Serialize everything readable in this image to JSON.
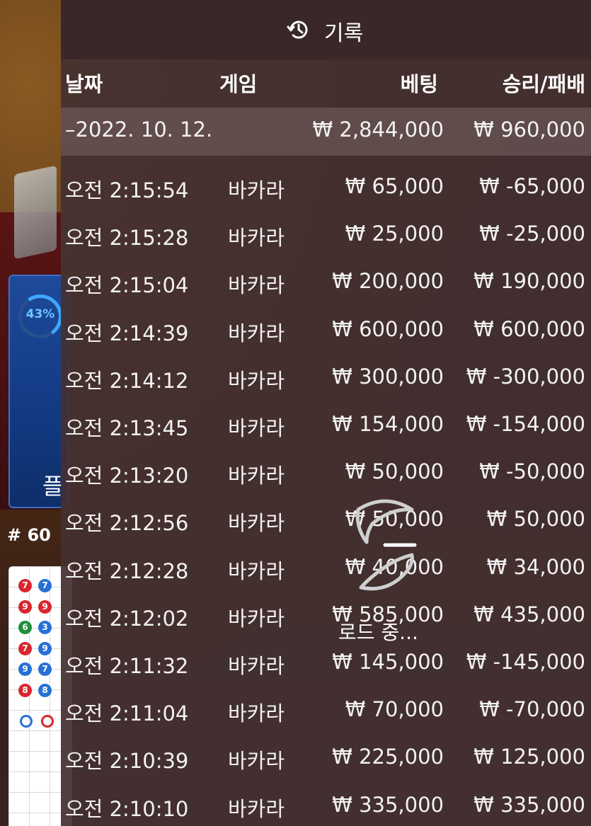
{
  "background": {
    "progress_percent": "43%",
    "player_label": "플",
    "round_number": "# 60",
    "beads": [
      {
        "value": "7",
        "color": "red"
      },
      {
        "value": "7",
        "color": "blue"
      },
      {
        "value": "9",
        "color": "red"
      },
      {
        "value": "9",
        "color": "red"
      },
      {
        "value": "6",
        "color": "green"
      },
      {
        "value": "3",
        "color": "blue"
      },
      {
        "value": "7",
        "color": "red"
      },
      {
        "value": "9",
        "color": "blue"
      },
      {
        "value": "9",
        "color": "blue"
      },
      {
        "value": "7",
        "color": "blue"
      },
      {
        "value": "8",
        "color": "red"
      },
      {
        "value": "8",
        "color": "blue"
      }
    ]
  },
  "panel": {
    "title": "기록",
    "icon": "history-icon",
    "columns": {
      "date": "날짜",
      "game": "게임",
      "bet": "베팅",
      "result": "승리/패배"
    },
    "summary": {
      "date": "–2022. 10. 12.",
      "bet": "₩ 2,844,000",
      "result": "₩ 960,000"
    },
    "rows": [
      {
        "time": "오전 2:15:54",
        "game": "바카라",
        "bet": "₩ 65,000",
        "result": "₩ -65,000"
      },
      {
        "time": "오전 2:15:28",
        "game": "바카라",
        "bet": "₩ 25,000",
        "result": "₩ -25,000"
      },
      {
        "time": "오전 2:15:04",
        "game": "바카라",
        "bet": "₩ 200,000",
        "result": "₩ 190,000"
      },
      {
        "time": "오전 2:14:39",
        "game": "바카라",
        "bet": "₩ 600,000",
        "result": "₩ 600,000"
      },
      {
        "time": "오전 2:14:12",
        "game": "바카라",
        "bet": "₩ 300,000",
        "result": "₩ -300,000"
      },
      {
        "time": "오전 2:13:45",
        "game": "바카라",
        "bet": "₩ 154,000",
        "result": "₩ -154,000"
      },
      {
        "time": "오전 2:13:20",
        "game": "바카라",
        "bet": "₩ 50,000",
        "result": "₩ -50,000"
      },
      {
        "time": "오전 2:12:56",
        "game": "바카라",
        "bet": "₩ 50,000",
        "result": "₩ 50,000"
      },
      {
        "time": "오전 2:12:28",
        "game": "바카라",
        "bet": "₩ 40,000",
        "result": "₩ 34,000"
      },
      {
        "time": "오전 2:12:02",
        "game": "바카라",
        "bet": "₩ 585,000",
        "result": "₩ 435,000"
      },
      {
        "time": "오전 2:11:32",
        "game": "바카라",
        "bet": "₩ 145,000",
        "result": "₩ -145,000"
      },
      {
        "time": "오전 2:11:04",
        "game": "바카라",
        "bet": "₩ 70,000",
        "result": "₩ -70,000"
      },
      {
        "time": "오전 2:10:39",
        "game": "바카라",
        "bet": "₩ 225,000",
        "result": "₩ 125,000"
      },
      {
        "time": "오전 2:10:10",
        "game": "바카라",
        "bet": "₩ 335,000",
        "result": "₩ 335,000"
      }
    ],
    "loading_text": "로드 중..."
  }
}
